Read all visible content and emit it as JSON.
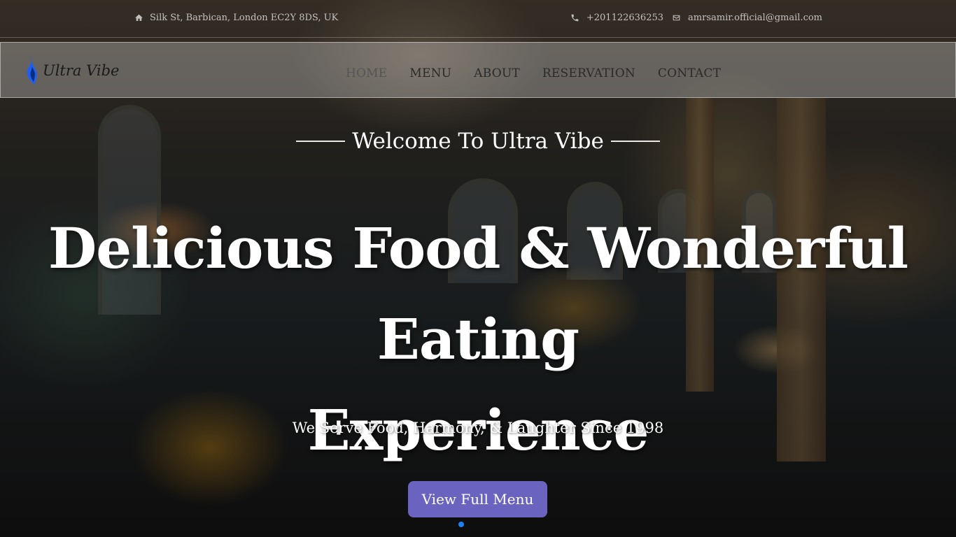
{
  "topbar": {
    "address": "Silk St, Barbican, London EC2Y 8DS, UK",
    "phone": "+201122636253",
    "email": "amrsamir.official@gmail.com"
  },
  "brand": {
    "name": "Ultra Vibe",
    "logo_color": "#1e5ff0"
  },
  "nav": {
    "items": [
      {
        "label": "HOME"
      },
      {
        "label": "MENU"
      },
      {
        "label": "ABOUT"
      },
      {
        "label": "RESERVATION"
      },
      {
        "label": "CONTACT"
      }
    ]
  },
  "hero": {
    "welcome": "Welcome To Ultra Vibe",
    "headline_line1": "Delicious Food & Wonderful Eating",
    "headline_line2": "Experience",
    "subline": "We Serve Food, Harmony, & Laughter Since 1998",
    "cta_label": "View Full Menu",
    "cta_color": "#6a63c0"
  }
}
